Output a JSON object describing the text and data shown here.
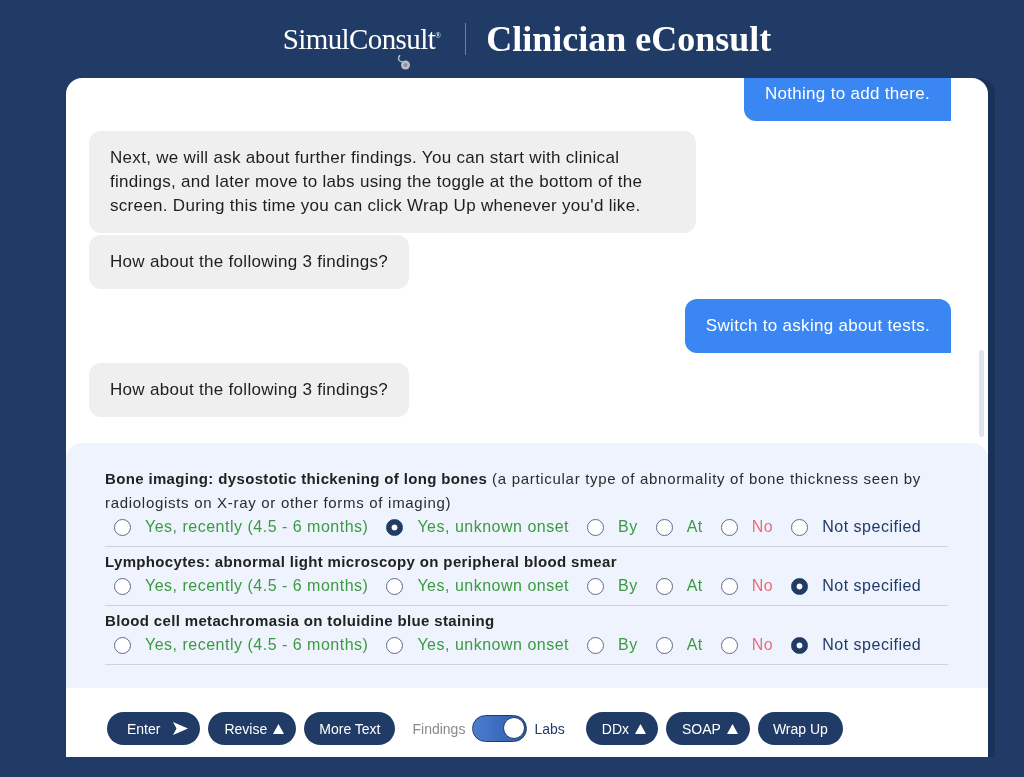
{
  "header": {
    "logo": "SimulConsult$^{®}$",
    "title": "Clinician eConsult"
  },
  "chat": {
    "messages": [
      {
        "kind": "outgoing",
        "text": "Nothing to add there."
      },
      {
        "kind": "incoming",
        "text": "Next, we will ask about further findings. You can start with clinical findings, and later move to labs using the toggle at the bottom of the screen. During this time you can click Wrap Up whenever you'd like."
      },
      {
        "kind": "incoming",
        "text": "How about the following 3 findings?"
      },
      {
        "kind": "outgoing",
        "text": "Switch to asking about tests."
      },
      {
        "kind": "incoming",
        "text": "How about the following 3 findings?"
      }
    ]
  },
  "findings": [
    {
      "name": "Bone imaging: dysostotic thickening of long bones",
      "description": "(a particular type of abnormality of bone thickness seen by radiologists on X-ray or other forms of imaging)",
      "options": [
        {
          "label": "Yes, recently (4.5 - 6 months)",
          "kind": "positive",
          "selected": false
        },
        {
          "label": "Yes, unknown onset",
          "kind": "positive",
          "selected": true
        },
        {
          "label": "By",
          "kind": "positive",
          "selected": false
        },
        {
          "label": "At",
          "kind": "positive",
          "selected": false
        },
        {
          "label": "No",
          "kind": "negative",
          "selected": false
        },
        {
          "label": "Not specified",
          "kind": "neutral",
          "selected": false
        }
      ]
    },
    {
      "name": "Lymphocytes: abnormal light microscopy on peripheral blood smear",
      "options": [
        {
          "label": "Yes, recently (4.5 - 6 months)",
          "kind": "positive",
          "selected": false
        },
        {
          "label": "Yes, unknown onset",
          "kind": "positive",
          "selected": false
        },
        {
          "label": "By",
          "kind": "positive",
          "selected": false
        },
        {
          "label": "At",
          "kind": "positive",
          "selected": false
        },
        {
          "label": "No",
          "kind": "negative",
          "selected": false
        },
        {
          "label": "Not specified",
          "kind": "neutral",
          "selected": true
        }
      ]
    },
    {
      "name": "Blood cell metachromasia on toluidine blue staining",
      "options": [
        {
          "label": "Yes, recently (4.5 - 6 months)",
          "kind": "positive",
          "selected": false
        },
        {
          "label": "Yes, unknown onset",
          "kind": "positive",
          "selected": false
        },
        {
          "label": "By",
          "kind": "positive",
          "selected": false
        },
        {
          "label": "At",
          "kind": "positive",
          "selected": false
        },
        {
          "label": "No",
          "kind": "negative",
          "selected": false
        },
        {
          "label": "Not specified",
          "kind": "neutral",
          "selected": true
        }
      ]
    }
  ],
  "actions": [
    {
      "kind": "send",
      "label": "Enter"
    },
    {
      "kind": "menu",
      "label": "Revise"
    },
    {
      "kind": "plain",
      "label": "More Text"
    },
    {
      "kind": "toggle",
      "left_label": "Findings",
      "right_label": "Labs",
      "on": true
    },
    {
      "kind": "menu",
      "label": "DDx"
    },
    {
      "kind": "menu",
      "label": "SOAP"
    },
    {
      "kind": "plain",
      "label": "Wrap Up"
    }
  ]
}
